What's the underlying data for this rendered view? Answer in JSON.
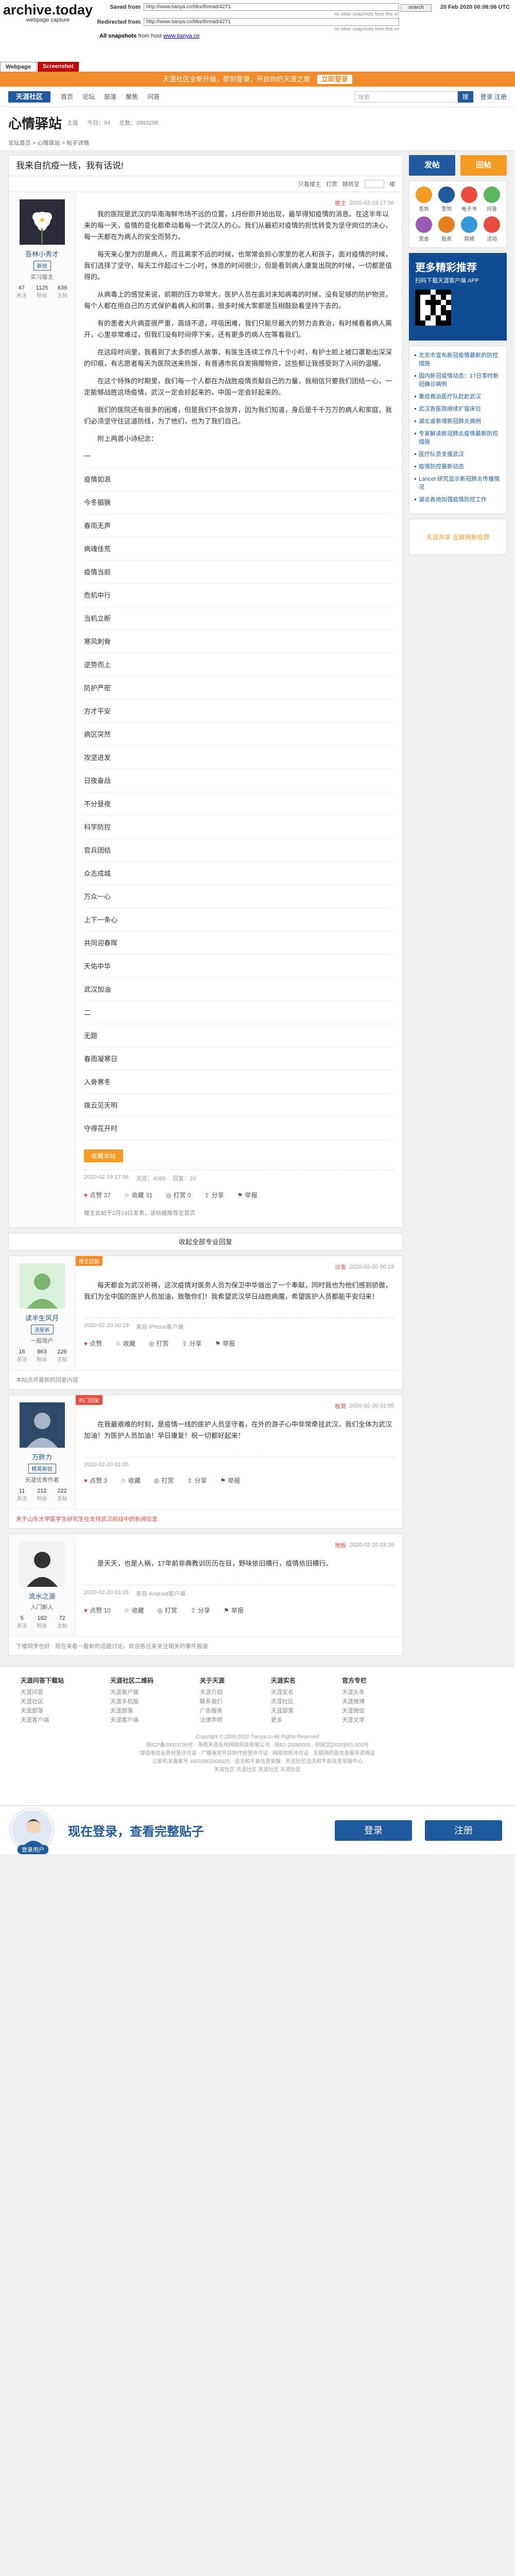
{
  "archive": {
    "logo": "archive.today",
    "subtitle": "webpage capture",
    "saved_from_label": "Saved from",
    "saved_from_url": "http://www.tianya.cn/bbs/thread/4271",
    "redirected_label": "Redirected from",
    "redirected_url": "http://www.tianya.cn/bbs/thread/4271",
    "hint": "no other snapshots from this url",
    "all_snapshots_label": "All snapshots",
    "all_snapshots_text": "from host",
    "all_snapshots_host": "www.tianya.cn",
    "search_btn": "search",
    "date": "20 Feb 2020 00:08:06 UTC",
    "tab_webpage": "Webpage",
    "tab_screenshot": "Screenshot"
  },
  "banner": {
    "text": "天涯社区全新升级，即刻登录，开启你的天涯之旅",
    "button": "立即登录"
  },
  "topnav": {
    "logo": "天涯社区",
    "items": [
      "首页",
      "论坛",
      "部落",
      "聚焦",
      "问答"
    ],
    "search_placeholder": "搜索",
    "search_btn": "搜",
    "login": "登录  注册"
  },
  "board": {
    "title": "心情驿站",
    "meta": [
      "主版",
      "今日：94",
      "总数：3993298"
    ],
    "crumbs": "论坛首页 > 心情驿站 > 帖子详情"
  },
  "thread": {
    "title": "我来自抗疫一线，我有话说!",
    "tools": [
      "只看楼主",
      "打赏",
      "跳转至",
      "楼"
    ],
    "op": {
      "name": "吾林小秀才",
      "badge": "新锐",
      "rank": "实习版主",
      "stats": [
        {
          "n": "47",
          "l": "关注"
        },
        {
          "n": "1125",
          "l": "粉丝"
        },
        {
          "n": "639",
          "l": "主帖"
        }
      ],
      "floor": "楼主",
      "time": "2020-02-19 17:56",
      "paragraphs": [
        "我的医院是武汉的华南海鲜市场不远的位置，1月份即开始出现，最早得知疫情的消息。在这半年以来的每一天，疫情的变化都牵动着每一个武汉人的心。我们从最初对疫情的担忧转变为坚守岗位的决心，每一天都在为病人的安全而努力。",
        "每天来心里为的是病人，而且离家不远的时候，也常常会担心家里的老人和孩子，面对疫情的时候，我们选择了坚守，每天工作超过十二小时，休息的时间很少，但是看到病人康复出院的时候，一切都是值得的。",
        "从病毒上的感觉来说，前期的压力非常大，医护人员在面对未知病毒的时候，没有足够的防护物资，每个人都在用自己的方式保护着病人和同事，很多时候大家都是互相鼓励着坚持下去的。",
        "有的患者大片病变很严重，高烧不退，呼吸困难，我们只能尽最大的努力去救治，有时候看着病人离开，心里非常难过，但我们没有时间停下来，还有更多的病人在等着我们。",
        "在这段时间里，我看到了太多的感人故事，有医生连续工作几十个小时，有护士脸上被口罩勒出深深的印痕，有志愿者每天为医院送来热饭，有普通市民自发捐赠物资，这些都让我感受到了人间的温暖。",
        "在这个特殊的时期里，我们每一个人都在为战胜疫情贡献自己的力量，我相信只要我们团结一心，一定能够战胜这场疫情，武汉一定会好起来的，中国一定会好起来的。",
        "我们的医院还有很多的困难，但是我们不会放弃，因为我们知道，身后是千千万万的病人和家庭，我们必须坚守住这道防线，为了他们，也为了我们自己。",
        "附上两首小诗纪念："
      ],
      "poem": [
        "一",
        "疫情如浪",
        "今冬猖獗",
        "春雨无声",
        "病魂佳荒",
        "疫情当前",
        "危机中行",
        "当机立断",
        "寒风刺骨",
        "逆势而上",
        "防护严密",
        "方才平安",
        "病区突然",
        "攻坚进发",
        "日夜奋战",
        "不分昼夜",
        "科学防控",
        "官兵团结",
        "众志成城",
        "万众一心",
        "上下一条心",
        "共同迎春晖",
        "天佑中华",
        "武汉加油",
        "二",
        "无题",
        "春雨凝寒日",
        "入骨寒冬",
        "拨云见天明",
        "守得花开时"
      ],
      "collect_btn": "收藏本帖",
      "foot": [
        "2020-02-19 17:56",
        "浏览：4089",
        "回复：20"
      ],
      "actions": [
        "点赞 37",
        "收藏 31",
        "打赏 0",
        "分享",
        "举报"
      ],
      "note": "楼主此帖于2月19日发表，该帖被推荐至首页"
    },
    "replies_title": "收起全部专业回复",
    "replies": [
      {
        "tag": "楼主回复",
        "name": "读半生风月",
        "badge": "流星新",
        "rank": "一般用户",
        "stats": [
          {
            "n": "16",
            "l": "关注"
          },
          {
            "n": "863",
            "l": "粉丝"
          },
          {
            "n": "226",
            "l": "主帖"
          }
        ],
        "floor": "沙发",
        "time": "2020-02-20 00:19",
        "paragraphs": [
          "每天都会为武汉祈祷，这次疫情对医务人员为保卫中华做出了一个奉献，同时我也为他们感到骄傲，我们为全中国的医护人员加油，致敬你们！我希望武汉早日战胜病魔，希望医护人员都能平安归来！"
        ],
        "foot": [
          "2020-02-20 00:19",
          "来自 iPhone客户端"
        ],
        "actions": [
          "点赞",
          "收藏",
          "打赏",
          "分享",
          "举报"
        ],
        "note": "本帖点评最新的回复内容"
      },
      {
        "tag": "热门回复",
        "name": "万胖力",
        "badge": "精英新锐",
        "rank": "天涯优秀作者",
        "stats": [
          {
            "n": "11",
            "l": "关注"
          },
          {
            "n": "212",
            "l": "粉丝"
          },
          {
            "n": "222",
            "l": "主帖"
          }
        ],
        "floor": "板凳",
        "time": "2020-02-20 01:05",
        "paragraphs": [
          "在我最艰难的时刻，是疫情一线的医护人员坚守着，在外的游子心中非常牵挂武汉，我们全体为武汉加油！为医护人员加油！早日康复！祝一切都好起来！"
        ],
        "foot": [
          "2020-02-20 01:05"
        ],
        "actions": [
          "点赞 3",
          "收藏",
          "打赏",
          "分享",
          "举报"
        ],
        "note": "关于山东大学医学生研究生在支持武汉前线中的新闻信息"
      },
      {
        "tag": "",
        "name": "流水之源",
        "badge": "",
        "rank": "入门新人",
        "stats": [
          {
            "n": "5",
            "l": "关注"
          },
          {
            "n": "182",
            "l": "粉丝"
          },
          {
            "n": "72",
            "l": "主帖"
          }
        ],
        "floor": "地板",
        "time": "2020-02-20 03:26",
        "paragraphs": [
          "是天天，也是人祸，17年前非典教训历历在目，野味依旧横行，疫情依旧横行。"
        ],
        "foot": [
          "2020-02-20 03:26",
          "来自 Android客户端"
        ],
        "actions": [
          "点赞 10",
          "收藏",
          "打赏",
          "分享",
          "举报"
        ],
        "note": "下楼同学也好 · 现在来看一看新的话题讨论，欢迎各位来关注相关的事件报道"
      }
    ]
  },
  "side": {
    "btn_post": "发帖",
    "btn_reply": "回帖",
    "icons": [
      "签到",
      "签到",
      "电子书",
      "问答",
      "赏金",
      "拍卖",
      "商城",
      "活动"
    ],
    "promo_title": "更多精彩推荐",
    "promo_sub": "扫码下载天涯客户端 APP",
    "list": [
      "北京市宣布新冠疫情最新的防控措施",
      "国内新冠疫情动态：17日零时新冠确诊病例",
      "重症救治医疗队赶赴武汉",
      "武汉各医院继续扩容床位",
      "湖北省新增新冠肺炎病例",
      "专家解读新冠肺炎疫情最新防控措施",
      "医疗队员支援武汉",
      "疫情防控最新动态",
      "Lancet 研究显示新冠肺炎传播情况",
      "湖北各地加强疫情防控工作"
    ],
    "ad_text": "天涯共享 互联网新视界"
  },
  "footer": {
    "cols": [
      {
        "h": "天涯问答下载站",
        "items": [
          "天涯问答",
          "天涯社区",
          "天涯部落",
          "天涯客户端"
        ]
      },
      {
        "h": "天涯社区二维码",
        "items": [
          "天涯客户端",
          "天涯手机版",
          "天涯部落",
          "天涯客户端"
        ]
      },
      {
        "h": "关于天涯",
        "items": [
          "天涯介绍",
          "联系我们",
          "广告服务",
          "法律声明"
        ]
      },
      {
        "h": "天涯实名",
        "items": [
          "天涯实名",
          "天涯社区",
          "天涯部落",
          "更多"
        ]
      },
      {
        "h": "官方专栏",
        "items": [
          "天涯头条",
          "天涯微博",
          "天涯微信",
          "天涯文学"
        ]
      }
    ],
    "copyright": "Copyright © 2000-2020 Tianya.cn All Rights Reserved",
    "lines": [
      "琼ICP备09003799号 · 海南天涯在线网络科技有限公司 · 琼B2-20080006 · 琼网文[2010]001-003号",
      "增值电信业务经营许可证 · 广播电视节目制作经营许可证 · 网络视听许可证 · 互联网药品信息服务资格证",
      "公安机关备案号 46010802000025 · 违法和不良信息举报 · 天涯社区违法和不良信息举报中心",
      "天涯社区 天涯社区 天涯社区 天涯社区"
    ]
  },
  "bottombar": {
    "tag": "登录用户",
    "text": "现在登录，查看完整贴子",
    "login": "登录",
    "register": "注册"
  }
}
